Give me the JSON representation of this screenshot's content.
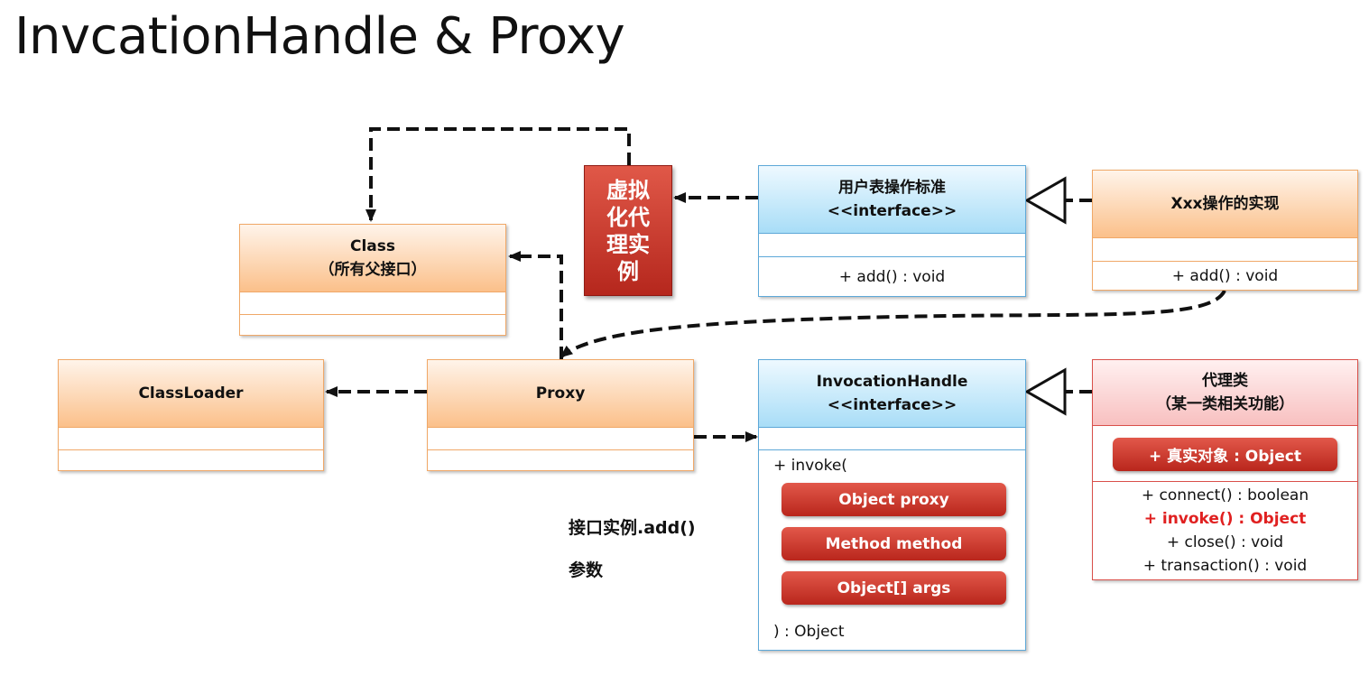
{
  "title": "InvcationHandle & Proxy",
  "virtual_instance": "虚拟化代理实例",
  "boxes": {
    "class_box": {
      "name": "Class",
      "subtitle": "（所有父接口）"
    },
    "user_interface": {
      "name": "用户表操作标准",
      "stereotype": "<<interface>>",
      "op": "+ add() : void"
    },
    "xxx_impl": {
      "name": "Xxx操作的实现",
      "op": "+ add() : void"
    },
    "classloader": {
      "name": "ClassLoader"
    },
    "proxy": {
      "name": "Proxy"
    },
    "invocation_handle": {
      "name": "InvocationHandle",
      "stereotype": "<<interface>>",
      "invoke_open": "+ invoke(",
      "params": [
        "Object proxy",
        "Method method",
        "Object[] args"
      ],
      "invoke_close": ") : Object"
    },
    "proxy_class": {
      "name": "代理类",
      "subtitle": "（某一类相关功能）",
      "attribute": "+ 真实对象 : Object",
      "ops": [
        "+ connect() : boolean",
        "+ invoke() : Object",
        "+ close() : void",
        "+ transaction() : void"
      ]
    }
  },
  "notes": {
    "call": "接口实例.add()",
    "params": "参数"
  },
  "colors": {
    "orange_border": "#f0a868",
    "blue_border": "#5da8d8",
    "red_border": "#d9504a",
    "highlight": "#e02020"
  }
}
